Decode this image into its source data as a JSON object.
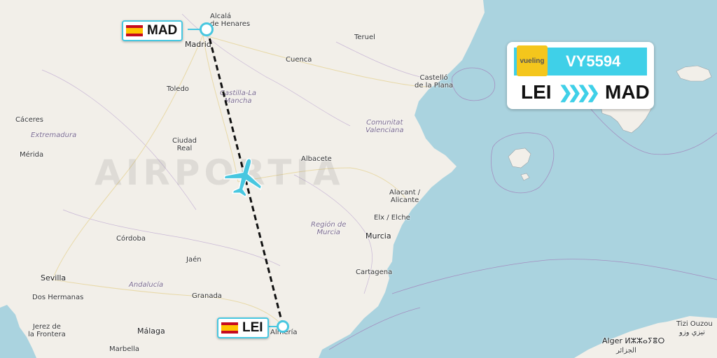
{
  "watermark": "AIRPORTIA",
  "flight": {
    "airline_logo_text": "vueling",
    "number": "VY5594",
    "origin": "LEI",
    "destination": "MAD",
    "route_arrow": "❯❯❯❯"
  },
  "airports": {
    "origin": {
      "code": "LEI",
      "flag": "spain-flag"
    },
    "destination": {
      "code": "MAD",
      "flag": "spain-flag"
    }
  },
  "places": {
    "alcala": "Alcalá\nde Henares",
    "madrid": "Madrid",
    "teruel": "Teruel",
    "cuenca": "Cuenca",
    "castellon": "Castelló\nde la Plana",
    "toledo": "Toledo",
    "castilla": "Castilla-La\nMancha",
    "caceres": "Cáceres",
    "extremadura": "Extremadura",
    "comunitat": "Comunitat\nValenciana",
    "merida": "Mérida",
    "ciudad_real": "Ciudad\nReal",
    "albacete": "Albacete",
    "alacant": "Alacant /\nAlicante",
    "region_murcia": "Región de\nMurcia",
    "elx": "Elx / Elche",
    "cordoba": "Córdoba",
    "murcia": "Murcia",
    "jaen": "Jaén",
    "cartagena": "Cartagena",
    "sevilla": "Sevilla",
    "andalucia": "Andalucía",
    "dos_hermanas": "Dos Hermanas",
    "granada": "Granada",
    "jerez": "Jerez de\nla Frontera",
    "malaga": "Málaga",
    "almeria": "Almería",
    "marbella": "Marbella",
    "tizi_ouzou": "Tizi Ouzou",
    "tizi_ouzou_ar": "تيزي وزو",
    "alger": "Alger ⵍⵣⵣⴰⵢⴻⵔ",
    "alger_ar": "الجزائر"
  },
  "colors": {
    "land": "#f2efe9",
    "sea": "#aad3df",
    "accent": "#48c7e0",
    "route": "#111111"
  }
}
